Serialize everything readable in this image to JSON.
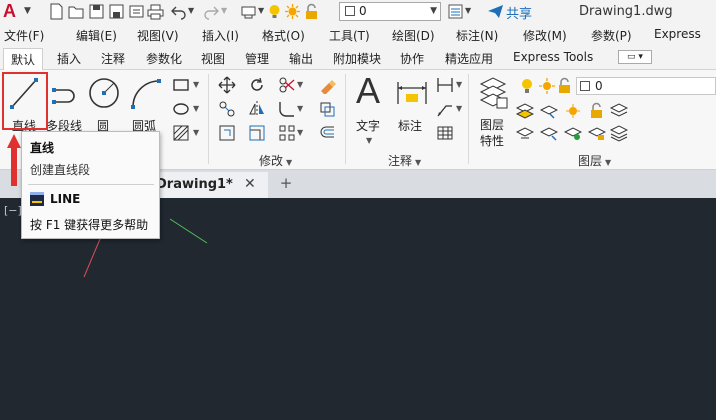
{
  "app": {
    "logo": "A",
    "workspace_value": "0",
    "share_label": "共享",
    "doc_title": "Drawing1.dwg"
  },
  "menu": [
    "文件(F)",
    "编辑(E)",
    "视图(V)",
    "插入(I)",
    "格式(O)",
    "工具(T)",
    "绘图(D)",
    "标注(N)",
    "修改(M)",
    "参数(P)",
    "Express"
  ],
  "ribbon_tabs": [
    "默认",
    "插入",
    "注释",
    "参数化",
    "视图",
    "管理",
    "输出",
    "附加模块",
    "协作",
    "精选应用",
    "Express Tools"
  ],
  "active_tab": "默认",
  "draw_tools": {
    "line": "直线",
    "polyline": "多段线",
    "circle": "圆",
    "arc": "圆弧"
  },
  "panels": {
    "modify": "修改",
    "annotation": "注释",
    "layers": "图层"
  },
  "annotation_tools": {
    "text": "文字",
    "dimension": "标注"
  },
  "layer_tools": {
    "properties_line1": "图层",
    "properties_line2": "特性",
    "current_layer": "0"
  },
  "file_tab": {
    "name": "Drawing1*",
    "close": "✕",
    "new": "+"
  },
  "viewport_label": "[−]",
  "tooltip": {
    "title": "直线",
    "description": "创建直线段",
    "command": "LINE",
    "help": "按 F1 键获得更多帮助"
  },
  "colors": {
    "canvas_bg": "#212830",
    "highlight": "#e03131",
    "accent_blue": "#1e6fb8"
  }
}
